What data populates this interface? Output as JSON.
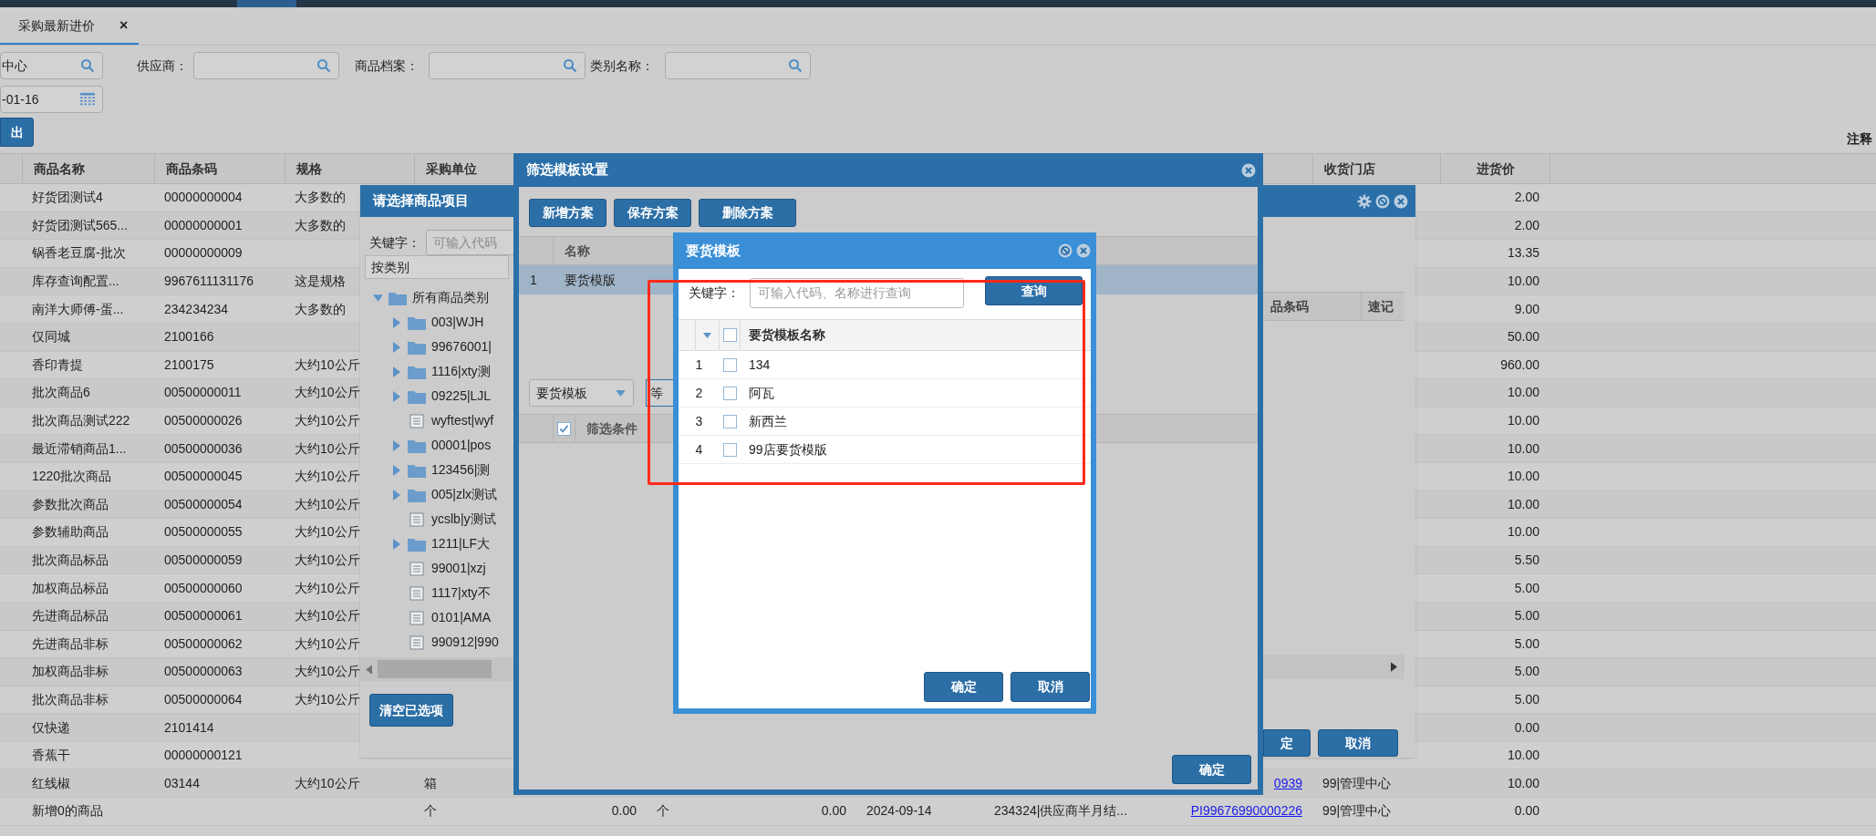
{
  "tabs": [
    {
      "label": "采购最新进价",
      "close": "×",
      "selected": true
    }
  ],
  "filters": [
    {
      "kind": "search",
      "value": "中心"
    },
    {
      "kind": "search",
      "label": "供应商："
    },
    {
      "kind": "search",
      "label": "商品档案："
    },
    {
      "kind": "search",
      "label": "类别名称："
    }
  ],
  "date_field": {
    "value": "-01-16"
  },
  "toolbar": {
    "button": "出",
    "note": "注释"
  },
  "table": {
    "columns": [
      "商品名称",
      "商品条码",
      "规格",
      "采购单位",
      "收货门店",
      "进货价"
    ],
    "rows": [
      {
        "name": "好货团测试4",
        "barcode": "00000000004",
        "spec": "大多数的",
        "price": "2.00"
      },
      {
        "name": "好货团测试565...",
        "barcode": "00000000001",
        "spec": "大多数的",
        "price": "2.00"
      },
      {
        "name": "锅香老豆腐-批次",
        "barcode": "00000000009",
        "price": "13.35"
      },
      {
        "name": "库存查询配置...",
        "barcode": "9967611131176",
        "spec": "这是规格",
        "price": "10.00"
      },
      {
        "name": "南洋大师傅-蛋...",
        "barcode": "234234234",
        "spec": "大多数的",
        "price": "9.00"
      },
      {
        "name": "仅同城",
        "barcode": "2100166",
        "price": "50.00"
      },
      {
        "name": "香印青提",
        "barcode": "2100175",
        "spec": "大约10公斤",
        "price": "960.00"
      },
      {
        "name": "批次商品6",
        "barcode": "00500000011",
        "spec": "大约10公斤",
        "price": "10.00"
      },
      {
        "name": "批次商品测试222",
        "barcode": "00500000026",
        "spec": "大约10公斤",
        "price": "10.00"
      },
      {
        "name": "最近滞销商品1...",
        "barcode": "00500000036",
        "spec": "大约10公斤",
        "price": "10.00"
      },
      {
        "name": "1220批次商品",
        "barcode": "00500000045",
        "spec": "大约10公斤",
        "price": "10.00"
      },
      {
        "name": "参数批次商品",
        "barcode": "00500000054",
        "spec": "大约10公斤",
        "price": "10.00"
      },
      {
        "name": "参数辅助商品",
        "barcode": "00500000055",
        "spec": "大约10公斤",
        "price": "10.00"
      },
      {
        "name": "批次商品标品",
        "barcode": "00500000059",
        "spec": "大约10公斤",
        "price": "5.50"
      },
      {
        "name": "加权商品标品",
        "barcode": "00500000060",
        "spec": "大约10公斤",
        "price": "5.00"
      },
      {
        "name": "先进商品标品",
        "barcode": "00500000061",
        "spec": "大约10公斤",
        "price": "5.00"
      },
      {
        "name": "先进商品非标",
        "barcode": "00500000062",
        "spec": "大约10公斤",
        "price": "5.00"
      },
      {
        "name": "加权商品非标",
        "barcode": "00500000063",
        "spec": "大约10公斤",
        "price": "5.00"
      },
      {
        "name": "批次商品非标",
        "barcode": "00500000064",
        "spec": "大约10公斤",
        "price": "5.00"
      },
      {
        "name": "仅快递",
        "barcode": "2101414",
        "price": "0.00"
      },
      {
        "name": "香蕉干",
        "barcode": "00000000121",
        "price": "10.00"
      },
      {
        "name": "红线椒",
        "barcode": "03144",
        "spec": "大约10公斤",
        "unit": "箱",
        "column_11": "0939",
        "store": "99|管理中心",
        "price": "10.00"
      },
      {
        "name": "新增0的商品",
        "unit": "个",
        "column_6": "0.00",
        "column_7": "个",
        "column_8": "0.00",
        "column_9": "2024-09-14",
        "column_10": "234324|供应商半月结...",
        "column_11": "PI99676990000226",
        "store": "99|管理中心",
        "price": "0.00"
      }
    ]
  },
  "product_picker": {
    "title": "请选择商品项目",
    "keyword_label": "关键字：",
    "keyword_placeholder": "可输入代码",
    "category_bar": "按类别",
    "tree": [
      {
        "label": "所有商品类别",
        "kind": "folder",
        "expanded": true,
        "children": [
          {
            "label": "003|WJH",
            "kind": "folder",
            "expanded": false
          },
          {
            "label": "99676001|",
            "kind": "folder",
            "expanded": false
          },
          {
            "label": "1116|xty测",
            "kind": "folder",
            "expanded": false
          },
          {
            "label": "09225|LJL",
            "kind": "folder",
            "expanded": false
          },
          {
            "label": "wyftest|wyf",
            "kind": "file"
          },
          {
            "label": "00001|pos",
            "kind": "folder",
            "expanded": false
          },
          {
            "label": "123456|测",
            "kind": "folder",
            "expanded": false
          },
          {
            "label": "005|zlx测试",
            "kind": "folder",
            "expanded": false
          },
          {
            "label": "ycslb|y测试",
            "kind": "file"
          },
          {
            "label": "1211|LF大",
            "kind": "folder",
            "expanded": false
          },
          {
            "label": "99001|xzj",
            "kind": "file"
          },
          {
            "label": "1117|xty不",
            "kind": "file"
          },
          {
            "label": "0101|AMA",
            "kind": "file"
          },
          {
            "label": "990912|990",
            "kind": "file"
          }
        ]
      }
    ],
    "clear_button": "清空已选项",
    "right_columns": [
      "品条码",
      "速记"
    ],
    "buttons": [
      "定",
      "取消"
    ]
  },
  "filter_template": {
    "title": "筛选模板设置",
    "buttons": [
      "新增方案",
      "保存方案",
      "删除方案"
    ],
    "list": {
      "column": "名称",
      "rows": [
        {
          "index": "1",
          "name": "要货模版",
          "selected": true
        }
      ]
    },
    "field_select": "要货模板",
    "operator": "等",
    "conditions": {
      "checked": true,
      "header": "筛选条件"
    },
    "ok_button": "确定"
  },
  "template_picker": {
    "title": "要货模板",
    "keyword_label": "关键字：",
    "keyword_placeholder": "可输入代码、名称进行查询",
    "search_button": "查询",
    "header_checked": false,
    "column": "要货模板名称",
    "rows": [
      {
        "index": "1",
        "name": "134",
        "checked": false
      },
      {
        "index": "2",
        "name": "阿瓦",
        "checked": false
      },
      {
        "index": "3",
        "name": "新西兰",
        "checked": false
      },
      {
        "index": "4",
        "name": "99店要货模版",
        "checked": false
      }
    ],
    "buttons": [
      "确定",
      "取消"
    ]
  }
}
